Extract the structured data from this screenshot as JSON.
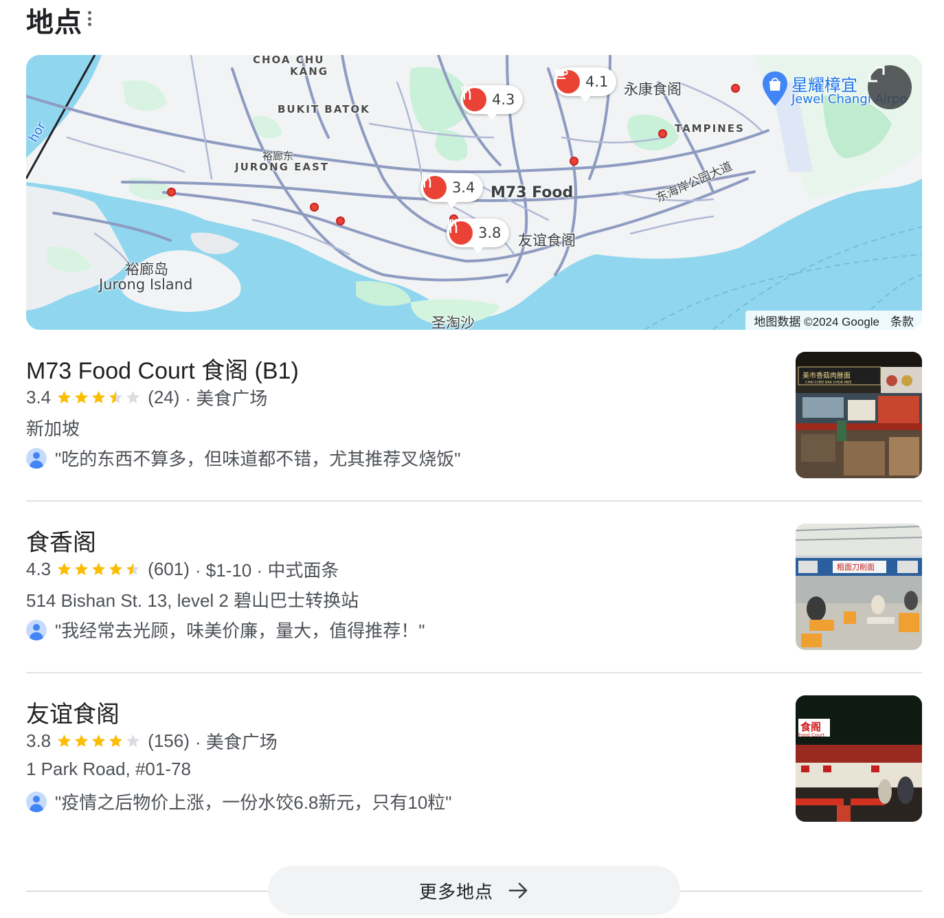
{
  "header": {
    "title": "地点",
    "more_icon": "more-vert-icon"
  },
  "map": {
    "labels": {
      "choa_chu_kang_1": "CHOA CHU",
      "choa_chu_kang_2": "KANG",
      "bukit_batok": "BUKIT BATOK",
      "jurong_east_cn": "裕廊东",
      "jurong_east": "JURONG EAST",
      "tampines": "TAMPINES",
      "jurong_island_cn": "裕廊岛",
      "jurong_island": "Jurong Island",
      "sentosa": "圣淘沙",
      "yongkang": "永康食阁",
      "m73": "M73 Food",
      "youyi": "友谊食阁",
      "ecp": "东海岸公园大道",
      "airport_cn": "星耀樟宜",
      "airport_en": "Jewel Changi Airpo",
      "johor": "hor"
    },
    "pins": [
      {
        "value": "4.3",
        "icon": "restaurant-icon"
      },
      {
        "value": "4.1",
        "icon": "cafe-icon"
      },
      {
        "value": "3.4",
        "icon": "restaurant-icon"
      },
      {
        "value": "3.8",
        "icon": "restaurant-icon"
      }
    ],
    "attribution": "地图数据 ©2024 Google",
    "terms": "条款",
    "colors": {
      "water": "#8fd6ee",
      "land": "#f1f3f4",
      "park": "#c9f0d9",
      "road": "#8e9bc1",
      "pin": "#ea4335"
    }
  },
  "results": [
    {
      "name": "M73 Food Court 食阁 (B1)",
      "rating": "3.4",
      "stars": 3.5,
      "reviews": "(24)",
      "meta": "· 美食广场",
      "address": "新加坡",
      "review": "\"吃的东西不算多，但味道都不错，尤其推荐叉烧饭\""
    },
    {
      "name": "食香阁",
      "rating": "4.3",
      "stars": 4.5,
      "reviews": "(601)",
      "meta": "· $1-10 · 中式面条",
      "address": "514 Bishan St. 13, level 2 碧山巴士转换站",
      "review": "\"我经常去光顾，味美价廉，量大，值得推荐！\""
    },
    {
      "name": "友谊食阁",
      "rating": "3.8",
      "stars": 4,
      "reviews": "(156)",
      "meta": "· 美食广场",
      "address": "1 Park Road, #01-78",
      "review": "\"疫情之后物价上涨，一份水饺6.8新元，只有10粒\""
    }
  ],
  "thumbnails": {
    "photo1_sign": "美市香菇肉脞面",
    "photo1_sign_en": "CHAI CHEE BAK CHOR MEE",
    "photo2_sign": "粗面刀削面",
    "photo3_sign_cn": "食阁",
    "photo3_sign_en": "Food Court"
  },
  "more_button": {
    "label": "更多地点",
    "icon": "arrow-right-icon"
  }
}
